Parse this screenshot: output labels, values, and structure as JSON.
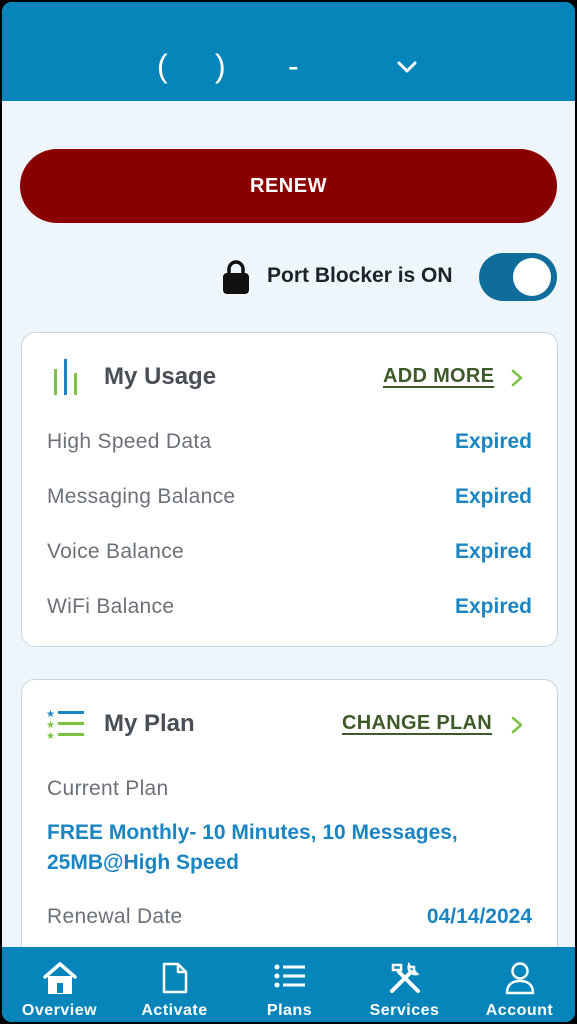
{
  "header": {
    "phone_open_paren": "(",
    "phone_close_paren": ")",
    "phone_dash": "-"
  },
  "renew_button": {
    "label": "RENEW"
  },
  "port_blocker": {
    "label": "Port Blocker is ON",
    "enabled": true
  },
  "usage_card": {
    "title": "My Usage",
    "link": "ADD MORE",
    "rows": [
      {
        "label": "High Speed Data",
        "value": "Expired"
      },
      {
        "label": "Messaging Balance",
        "value": "Expired"
      },
      {
        "label": "Voice Balance",
        "value": "Expired"
      },
      {
        "label": "WiFi Balance",
        "value": "Expired"
      }
    ]
  },
  "plan_card": {
    "title": "My Plan",
    "link": "CHANGE PLAN",
    "current_plan_label": "Current Plan",
    "current_plan_value": "FREE Monthly- 10 Minutes, 10 Messages, 25MB@High Speed",
    "renewal_label": "Renewal Date",
    "renewal_value": "04/14/2024"
  },
  "bottom_nav": {
    "items": [
      {
        "label": "Overview",
        "icon": "home-icon"
      },
      {
        "label": "Activate",
        "icon": "document-icon"
      },
      {
        "label": "Plans",
        "icon": "list-icon"
      },
      {
        "label": "Services",
        "icon": "tools-icon"
      },
      {
        "label": "Account",
        "icon": "person-icon"
      }
    ]
  },
  "colors": {
    "brand_blue": "#0585b9",
    "renew_red": "#8a0000",
    "value_blue": "#1b85c2",
    "link_green": "#3f5a2a",
    "accent_green": "#7dc242"
  }
}
